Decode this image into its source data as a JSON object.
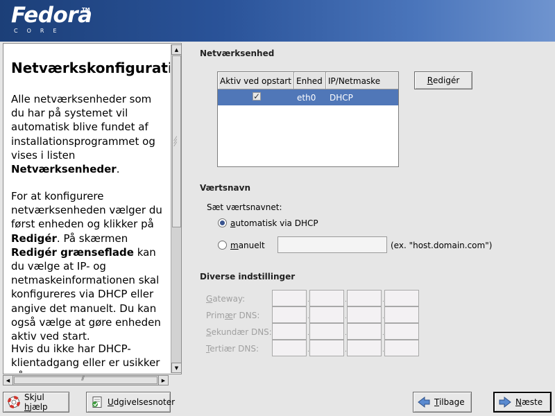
{
  "header": {
    "logo_name": "Fedora",
    "logo_tm": "TM",
    "logo_sub": "CORE"
  },
  "help": {
    "title": "Netværkskonfiguration",
    "p1_text": "Alle netværksenheder som du har på systemet vil automatisk blive fundet af installationsprogrammet og vises i listen ",
    "p1_bold": "Netværksenheder",
    "p1_end": ".",
    "p2_a": "For at konfigurere netværksenheden vælger du først enheden og klikker på ",
    "p2_bold1": "Redigér",
    "p2_b": ". På skærmen ",
    "p2_bold2": "Redigér grænseflade",
    "p2_c": " kan du vælge at IP- og netmaskeinformationen skal konfigureres via DHCP eller angive det manuelt. Du kan også vælge at gøre enheden aktiv ved start.",
    "p3": "Hvis du ikke har DHCP-klientadgang eller er usikker på"
  },
  "network_devices": {
    "section_title": "Netværksenhed",
    "columns": [
      "Aktiv ved opstart",
      "Enhed",
      "IP/Netmaske"
    ],
    "rows": [
      {
        "active": true,
        "device": "eth0",
        "ip_netmask": "DHCP"
      }
    ],
    "active_check_glyph": "✓",
    "edit_label_underlined": "R",
    "edit_label_rest": "edigér"
  },
  "hostname": {
    "section_title": "Værtsnavn",
    "set_label": "Sæt værtsnavnet:",
    "auto_underlined": "a",
    "auto_rest": "utomatisk via DHCP",
    "manual_underlined": "m",
    "manual_rest": "anuelt",
    "selected": "auto",
    "input_value": "",
    "example": "(ex. \"host.domain.com\")"
  },
  "misc": {
    "section_title": "Diverse indstillinger",
    "fields": [
      {
        "u": "G",
        "rest": "ateway:"
      },
      {
        "u": "",
        "pre": "Prim",
        "u2": "æ",
        "rest": "r DNS:"
      },
      {
        "u": "S",
        "rest": "ekundær DNS:"
      },
      {
        "u": "T",
        "rest": "ertiær DNS:"
      }
    ]
  },
  "buttons": {
    "hide_help_pre": "Skjul ",
    "hide_help_u": "h",
    "hide_help_rest": "jælp",
    "release_notes_u": "U",
    "release_notes_rest": "dgivelsesnoter",
    "back_u": "T",
    "back_rest": "ilbage",
    "next_u": "N",
    "next_rest": "æste"
  },
  "colors": {
    "header_start": "#1c3f78",
    "header_end": "#6f94cf",
    "selection": "#5077b8",
    "background": "#e6e6e6"
  },
  "icons": [
    "help-lifebuoy-icon",
    "release-notes-icon",
    "back-arrow-icon",
    "next-arrow-icon"
  ]
}
